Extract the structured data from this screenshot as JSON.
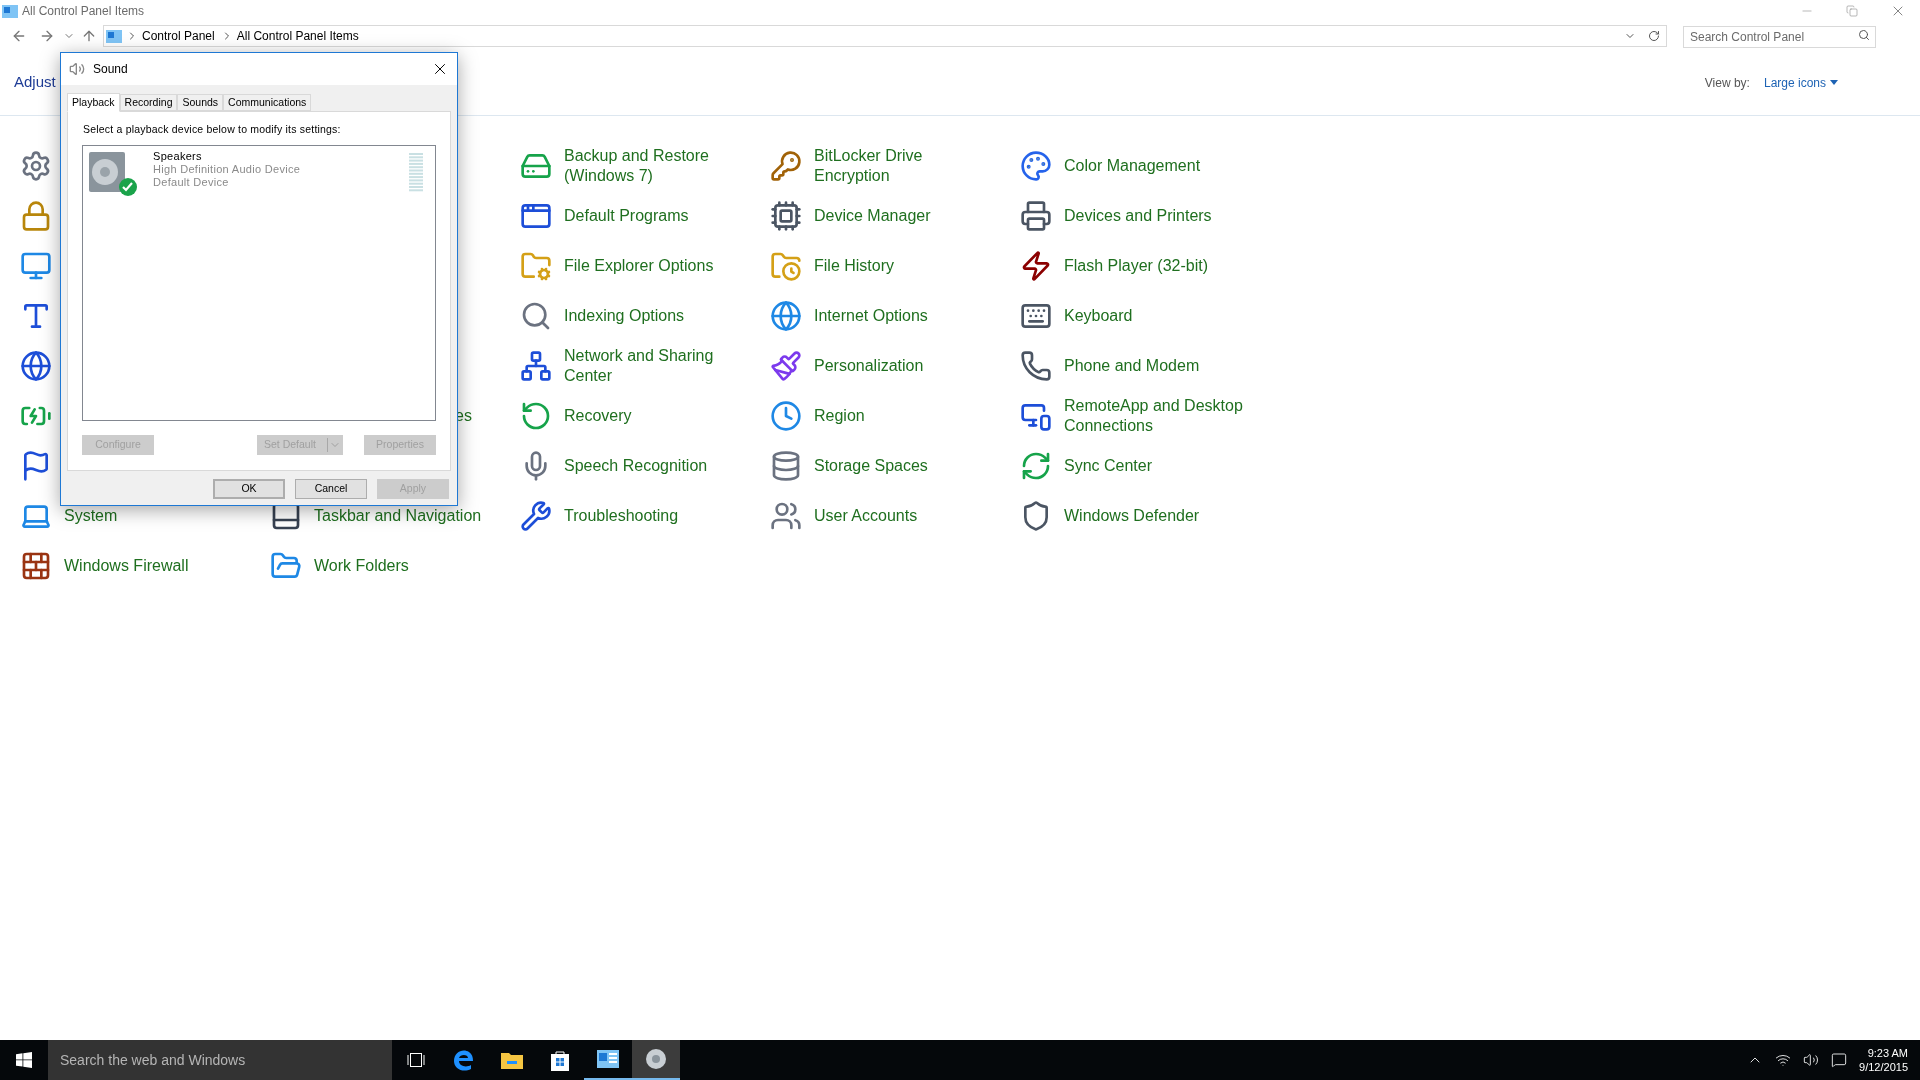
{
  "window": {
    "title": "All Control Panel Items"
  },
  "address": {
    "crumbs": [
      "Control Panel",
      "All Control Panel Items"
    ],
    "search_placeholder": "Search Control Panel"
  },
  "header": {
    "heading": "Adjust",
    "view_by_label": "View by:",
    "view_by_value": "Large icons"
  },
  "grid": [
    [
      {
        "kind": "icon_only"
      },
      {
        "kind": "covered"
      },
      {
        "kind": "item",
        "label": "Backup and Restore (Windows 7)"
      },
      {
        "kind": "item",
        "label": "BitLocker Drive Encryption"
      },
      {
        "kind": "item",
        "label": "Color Management"
      }
    ],
    [
      {
        "kind": "icon_only"
      },
      {
        "kind": "covered"
      },
      {
        "kind": "item",
        "label": "Default Programs"
      },
      {
        "kind": "item",
        "label": "Device Manager"
      },
      {
        "kind": "item",
        "label": "Devices and Printers"
      }
    ],
    [
      {
        "kind": "icon_only"
      },
      {
        "kind": "covered"
      },
      {
        "kind": "item",
        "label": "File Explorer Options"
      },
      {
        "kind": "item",
        "label": "File History"
      },
      {
        "kind": "item",
        "label": "Flash Player (32-bit)"
      }
    ],
    [
      {
        "kind": "icon_only"
      },
      {
        "kind": "covered"
      },
      {
        "kind": "item",
        "label": "Indexing Options"
      },
      {
        "kind": "item",
        "label": "Internet Options"
      },
      {
        "kind": "item",
        "label": "Keyboard"
      }
    ],
    [
      {
        "kind": "icon_only"
      },
      {
        "kind": "covered"
      },
      {
        "kind": "item",
        "label": "Network and Sharing Center"
      },
      {
        "kind": "item",
        "label": "Personalization"
      },
      {
        "kind": "item",
        "label": "Phone and Modem"
      }
    ],
    [
      {
        "kind": "icon_only"
      },
      {
        "kind": "clipped",
        "label": "es"
      },
      {
        "kind": "item",
        "label": "Recovery"
      },
      {
        "kind": "item",
        "label": "Region"
      },
      {
        "kind": "item",
        "label": "RemoteApp and Desktop Connections"
      }
    ],
    [
      {
        "kind": "icon_only"
      },
      {
        "kind": "covered"
      },
      {
        "kind": "item",
        "label": "Speech Recognition"
      },
      {
        "kind": "item",
        "label": "Storage Spaces"
      },
      {
        "kind": "item",
        "label": "Sync Center"
      }
    ],
    [
      {
        "kind": "item",
        "label": "System"
      },
      {
        "kind": "item",
        "label": "Taskbar and Navigation"
      },
      {
        "kind": "item",
        "label": "Troubleshooting"
      },
      {
        "kind": "item",
        "label": "User Accounts"
      },
      {
        "kind": "item",
        "label": "Windows Defender"
      }
    ],
    [
      {
        "kind": "item",
        "label": "Windows Firewall"
      },
      {
        "kind": "item",
        "label": "Work Folders"
      }
    ]
  ],
  "dialog": {
    "title": "Sound",
    "tabs": [
      {
        "label": "Playback",
        "selected": true
      },
      {
        "label": "Recording",
        "selected": false
      },
      {
        "label": "Sounds",
        "selected": false
      },
      {
        "label": "Communications",
        "selected": false
      }
    ],
    "instruction": "Select a playback device below to modify its settings:",
    "devices": [
      {
        "name": "Speakers",
        "description": "High Definition Audio Device",
        "status": "Default Device",
        "default": true
      }
    ],
    "device_buttons": [
      {
        "label": "Configure",
        "disabled": true,
        "kind": "plain"
      },
      {
        "label": "Set Default",
        "disabled": true,
        "kind": "split"
      },
      {
        "label": "Properties",
        "disabled": true,
        "kind": "plain"
      }
    ],
    "buttons": [
      {
        "label": "OK",
        "disabled": false,
        "default": true
      },
      {
        "label": "Cancel",
        "disabled": false,
        "default": false
      },
      {
        "label": "Apply",
        "disabled": true,
        "default": false
      }
    ]
  },
  "taskbar": {
    "search_placeholder": "Search the web and Windows",
    "apps": [
      {
        "kind": "taskview",
        "running": false,
        "selected": false
      },
      {
        "kind": "edge",
        "running": false,
        "selected": false
      },
      {
        "kind": "explorer",
        "running": false,
        "selected": false
      },
      {
        "kind": "store",
        "running": false,
        "selected": false
      },
      {
        "kind": "control",
        "running": true,
        "selected": false
      },
      {
        "kind": "sound",
        "running": true,
        "selected": true
      }
    ],
    "time": "9:23 AM",
    "date": "9/12/2015"
  }
}
